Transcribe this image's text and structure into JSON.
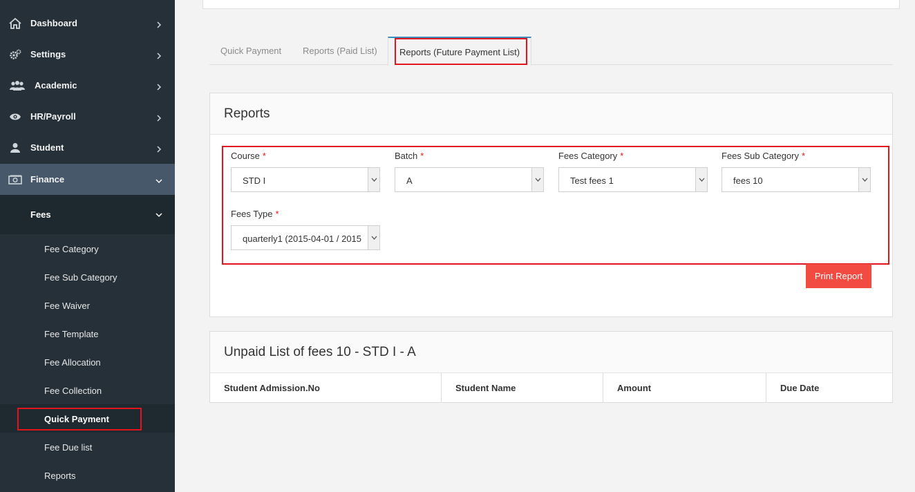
{
  "sidebar": {
    "items": [
      {
        "label": "Dashboard",
        "icon": "home-icon"
      },
      {
        "label": "Settings",
        "icon": "gear-icon"
      },
      {
        "label": "Academic",
        "icon": "users-icon"
      },
      {
        "label": "HR/Payroll",
        "icon": "eye-icon"
      },
      {
        "label": "Student",
        "icon": "user-icon"
      },
      {
        "label": "Finance",
        "icon": "money-icon"
      }
    ],
    "fees_label": "Fees",
    "fees_items": [
      "Fee Category",
      "Fee Sub Category",
      "Fee Waiver",
      "Fee Template",
      "Fee Allocation",
      "Fee Collection",
      "Quick Payment",
      "Fee Due list",
      "Reports"
    ]
  },
  "tabs": [
    "Quick Payment",
    "Reports (Paid List)",
    "Reports (Future Payment List)"
  ],
  "reports_panel": {
    "title": "Reports",
    "fields": {
      "course": {
        "label": "Course",
        "required": "*",
        "value": "STD I"
      },
      "batch": {
        "label": "Batch",
        "required": "*",
        "value": "A"
      },
      "fees_category": {
        "label": "Fees Category",
        "required": "*",
        "value": "Test fees 1"
      },
      "fees_sub_category": {
        "label": "Fees Sub Category",
        "required": "*",
        "value": "fees 10"
      },
      "fees_type": {
        "label": "Fees Type",
        "required": "*",
        "value": "quarterly1 (2015-04-01 / 2015"
      }
    },
    "print_button": "Print Report"
  },
  "unpaid_panel": {
    "title": "Unpaid List of fees 10 - STD I - A",
    "columns": [
      "Student Admission.No",
      "Student Name",
      "Amount",
      "Due Date"
    ]
  },
  "colors": {
    "sidebar": "#253038",
    "active_nav": "#47586a",
    "highlight": "#e3141b",
    "button": "#f14b42"
  }
}
